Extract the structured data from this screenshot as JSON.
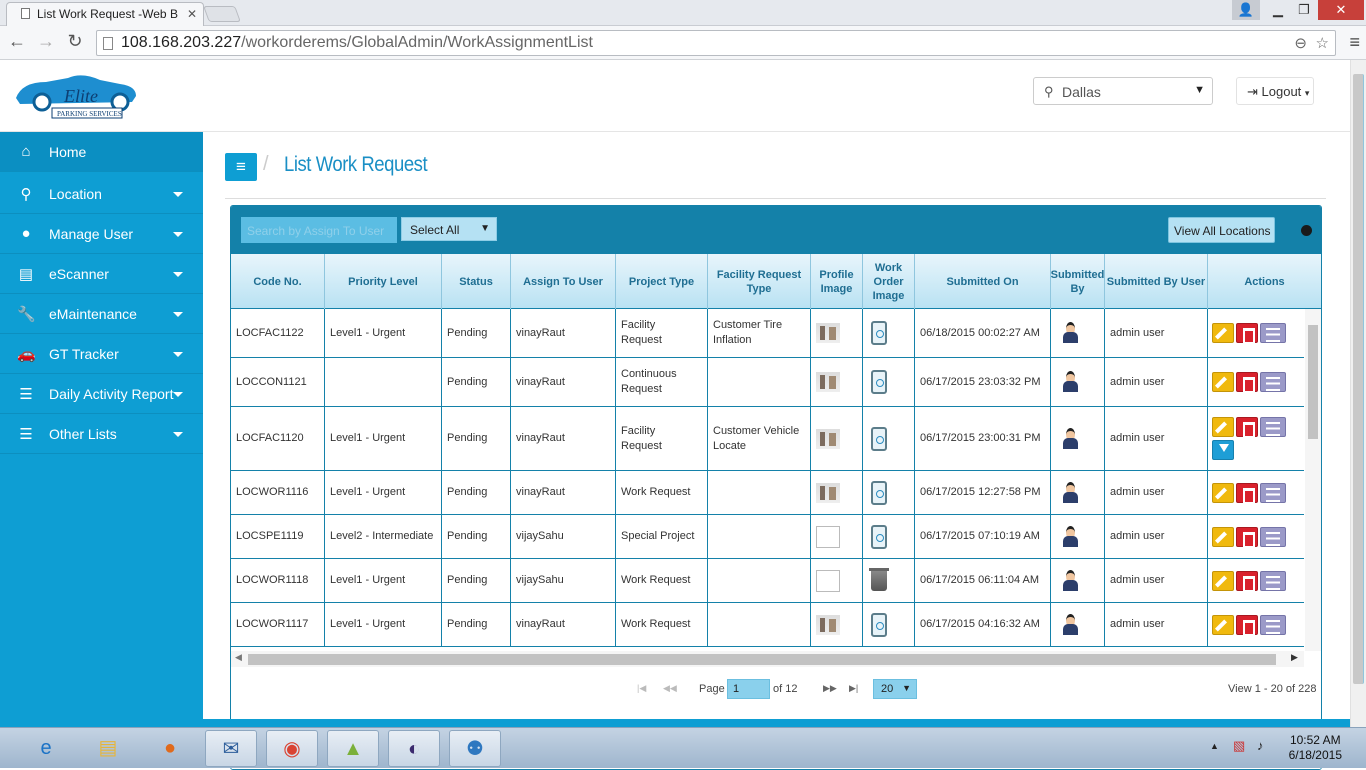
{
  "browser": {
    "tab_title": "List Work Request -Web B",
    "url_host": "108.168.203.227",
    "url_path": "/workorderems/GlobalAdmin/WorkAssignmentList"
  },
  "header": {
    "location": "Dallas",
    "logout_label": "Logout"
  },
  "sidebar": {
    "items": [
      {
        "label": "Home",
        "icon": "home-icon"
      },
      {
        "label": "Location",
        "icon": "map-pin-icon"
      },
      {
        "label": "Manage User",
        "icon": "user-icon"
      },
      {
        "label": "eScanner",
        "icon": "printer-icon"
      },
      {
        "label": "eMaintenance",
        "icon": "wrench-icon"
      },
      {
        "label": "GT Tracker",
        "icon": "car-icon"
      },
      {
        "label": "Daily Activity Report",
        "icon": "list-icon"
      },
      {
        "label": "Other Lists",
        "icon": "list-icon"
      }
    ]
  },
  "page": {
    "title": "List Work Request"
  },
  "toolbar": {
    "search_placeholder": "Search by Assign To User",
    "filter_value": "Select All",
    "view_all_label": "View All Locations"
  },
  "table": {
    "columns": [
      "Code No.",
      "Priority Level",
      "Status",
      "Assign To User",
      "Project Type",
      "Facility Request Type",
      "Profile Image",
      "Work Order Image",
      "Submitted On",
      "Submitted By",
      "Submitted By User",
      "Actions"
    ],
    "rows": [
      {
        "code": "LOCFAC1122",
        "priority": "Level1 - Urgent",
        "status": "Pending",
        "user": "vinayRaut",
        "project": "Facility Request",
        "facility": "Customer Tire Inflation",
        "submitted_on": "06/18/2015 00:02:27 AM",
        "submitted_by_user": "admin user"
      },
      {
        "code": "LOCCON1121",
        "priority": "",
        "status": "Pending",
        "user": "vinayRaut",
        "project": "Continuous Request",
        "facility": "",
        "submitted_on": "06/17/2015 23:03:32 PM",
        "submitted_by_user": "admin user"
      },
      {
        "code": "LOCFAC1120",
        "priority": "Level1 - Urgent",
        "status": "Pending",
        "user": "vinayRaut",
        "project": "Facility Request",
        "facility": "Customer Vehicle Locate",
        "submitted_on": "06/17/2015 23:00:31 PM",
        "submitted_by_user": "admin user"
      },
      {
        "code": "LOCWOR1116",
        "priority": "Level1 - Urgent",
        "status": "Pending",
        "user": "vinayRaut",
        "project": "Work Request",
        "facility": "",
        "submitted_on": "06/17/2015 12:27:58 PM",
        "submitted_by_user": "admin user"
      },
      {
        "code": "LOCSPE1119",
        "priority": "Level2 - Intermediate",
        "status": "Pending",
        "user": "vijaySahu",
        "project": "Special Project",
        "facility": "",
        "submitted_on": "06/17/2015 07:10:19 AM",
        "submitted_by_user": "admin user"
      },
      {
        "code": "LOCWOR1118",
        "priority": "Level1 - Urgent",
        "status": "Pending",
        "user": "vijaySahu",
        "project": "Work Request",
        "facility": "",
        "submitted_on": "06/17/2015 06:11:04 AM",
        "submitted_by_user": "admin user"
      },
      {
        "code": "LOCWOR1117",
        "priority": "Level1 - Urgent",
        "status": "Pending",
        "user": "vinayRaut",
        "project": "Work Request",
        "facility": "",
        "submitted_on": "06/17/2015 04:16:32 AM",
        "submitted_by_user": "admin user"
      }
    ]
  },
  "pager": {
    "page_label": "Page",
    "page_value": "1",
    "of_label": "of 12",
    "page_size": "20",
    "summary": "View 1 - 20 of 228"
  },
  "taskbar": {
    "time": "10:52 AM",
    "date": "6/18/2015"
  },
  "colors": {
    "sidebar": "#0e9ed3",
    "panel_header": "#1481a9",
    "title": "#1a8fc5"
  }
}
